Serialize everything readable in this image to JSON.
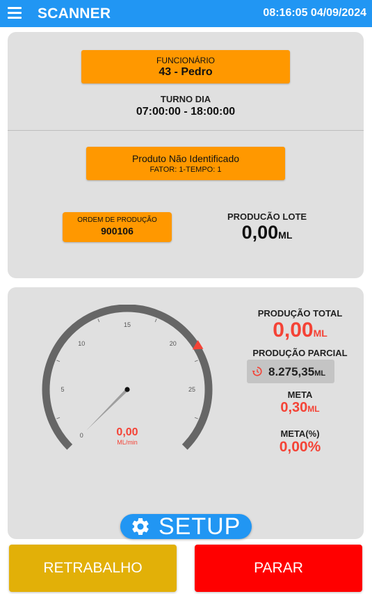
{
  "appbar": {
    "menu_icon": "menu-icon",
    "title": "SCANNER",
    "time": "08:16:05",
    "date": "04/09/2024",
    "color": "#2196f3"
  },
  "funcionario": {
    "label": "FUNCIONÁRIO",
    "value": "43 - Pedro"
  },
  "turno": {
    "label": "TURNO DIA",
    "value": "07:00:00 - 18:00:00"
  },
  "produto": {
    "name": "Produto Não Identificado",
    "fator": "FATOR: 1-TEMPO: 1"
  },
  "ordem": {
    "label": "ORDEM DE PRODUÇÃO",
    "value": "900106"
  },
  "lote": {
    "label": "PRODUCÃO LOTE",
    "value": "0,00",
    "unit": "ML"
  },
  "gauge": {
    "min": 0,
    "max": 30,
    "ticks": [
      "0",
      "5",
      "10",
      "15",
      "20",
      "25"
    ],
    "value": 0,
    "value_text": "0,00",
    "unit": "ML/min",
    "meta_marker": 21.5,
    "value_color": "#f44336",
    "arc_color": "#666666"
  },
  "stats": {
    "total_label": "PRODUÇÃO TOTAL",
    "total_value": "0,00",
    "total_unit": "ML",
    "parcial_label": "PRODUÇÃO PARCIAL",
    "parcial_icon": "history-icon",
    "parcial_value": "8.275,35",
    "parcial_unit": "ML",
    "meta_label": "META",
    "meta_value": "0,30",
    "meta_unit": "ML",
    "meta_pct_label": "META(%)",
    "meta_pct_value": "0,00%",
    "value_color": "#f44336"
  },
  "setup": {
    "icon": "gear-icon",
    "label": "SETUP"
  },
  "actions": {
    "retrabalho": "RETRABALHO",
    "parar": "PARAR",
    "retrabalho_color": "#e2b008",
    "parar_color": "#ff0000"
  }
}
